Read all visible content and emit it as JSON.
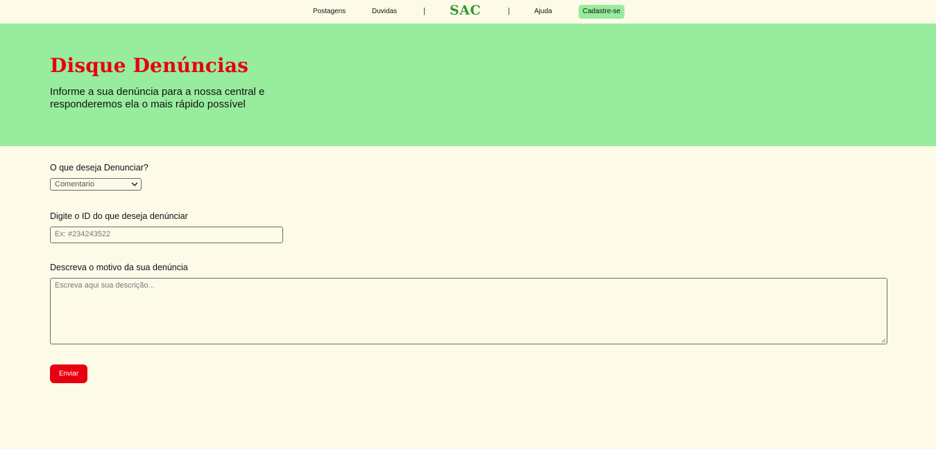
{
  "nav": {
    "links": [
      "Postagens",
      "Duvidas",
      "Ajuda"
    ],
    "separator": "|",
    "logo": "SAC",
    "cta_label": "Cadastre-se",
    "cta_color": "#97ec9d"
  },
  "hero": {
    "title": "Disque Denúncias",
    "subtitle": "Informe a sua denúncia para a nossa central e responderemos ela o mais rápido possível",
    "background": "#97ec9d",
    "title_color": "#e8000f"
  },
  "form": {
    "type_label": "O que deseja Denunciar?",
    "type_selected": "Comentario",
    "id_label": "Digite o ID do que deseja denúnciar",
    "id_placeholder": "Ex: #234243522",
    "reason_label": "Descreva o motivo da sua denúncia",
    "reason_placeholder": "Escreva aqui sua descrição...",
    "submit_label": "Enviar",
    "submit_color": "#e8000f"
  },
  "icons": {
    "select_chevron": "chevron-down-icon",
    "resize_handle": "resize-handle-icon"
  }
}
